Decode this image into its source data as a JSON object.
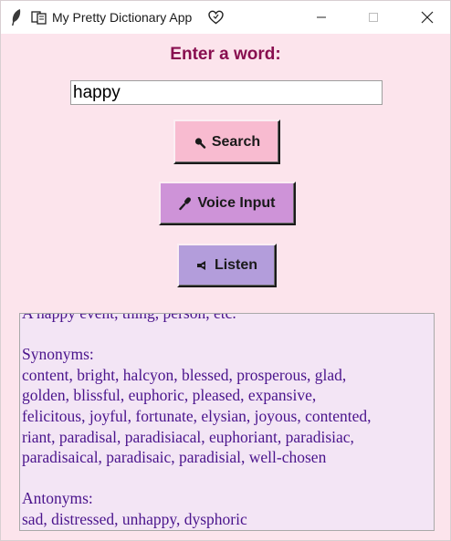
{
  "window": {
    "title": "My Pretty Dictionary App",
    "icons": [
      "feather-icon",
      "book-icon",
      "heart-icon"
    ],
    "controls": [
      "minimize-icon",
      "maximize-icon",
      "close-icon"
    ]
  },
  "main": {
    "heading": "Enter a word:",
    "input_value": "happy",
    "search_label": "Search",
    "search_icon": "magnifier-icon",
    "voice_label": "Voice Input",
    "voice_icon": "microphone-icon",
    "listen_label": "Listen",
    "listen_icon": "speaker-icon"
  },
  "result": {
    "lines": [
      "A happy event, thing, person, etc.",
      "",
      "Synonyms:",
      "content, bright, halcyon, blessed, prosperous, glad,",
      "golden, blissful, euphoric, pleased, expansive,",
      "felicitous, joyful, fortunate, elysian, joyous, contented,",
      "riant, paradisal, paradisiacal, euphoriant, paradisiac,",
      "paradisaical, paradisaic, paradisial, well-chosen",
      "",
      "Antonyms:",
      "sad, distressed, unhappy, dysphoric"
    ]
  },
  "colors": {
    "background": "#fce4ec",
    "heading": "#880e4f",
    "search_button": "#f8bbd0",
    "voice_button": "#ce93d8",
    "listen_button": "#b39ddb",
    "result_background": "#f3e5f5",
    "result_text": "#4a148c"
  }
}
